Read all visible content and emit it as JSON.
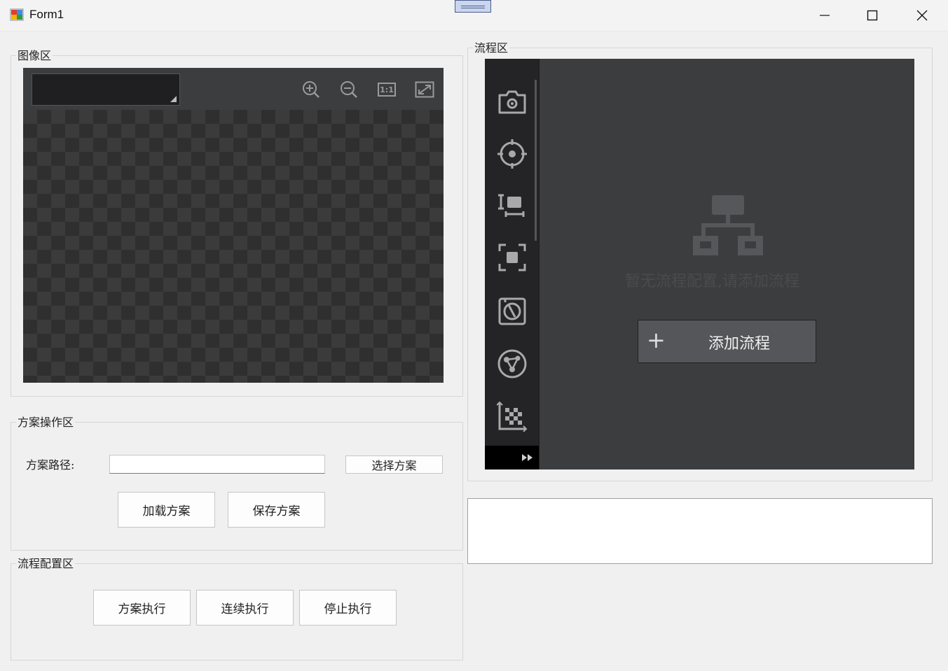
{
  "window": {
    "title": "Form1"
  },
  "image_area": {
    "legend": "图像区",
    "toolbar_icons": [
      "zoom-in-icon",
      "zoom-out-icon",
      "actual-size-icon",
      "fit-window-icon"
    ],
    "actual_size_label": "1:1",
    "combo_value": ""
  },
  "plan_ops": {
    "legend": "方案操作区",
    "path_label": "方案路径:",
    "path_value": "",
    "select_button": "选择方案",
    "load_button": "加载方案",
    "save_button": "保存方案"
  },
  "flow_config": {
    "legend": "流程配置区",
    "run_button": "方案执行",
    "continuous_button": "连续执行",
    "stop_button": "停止执行"
  },
  "flow_area": {
    "legend": "流程区",
    "side_icons": [
      "camera-icon",
      "target-icon",
      "text-measure-icon",
      "focus-frame-icon",
      "calibration-icon",
      "network-icon",
      "qr-code-icon"
    ],
    "expand_icon": "fast-forward-icon",
    "empty_message": "暂无流程配置,请添加流程",
    "add_button": "添加流程"
  },
  "log": {
    "text": ""
  }
}
